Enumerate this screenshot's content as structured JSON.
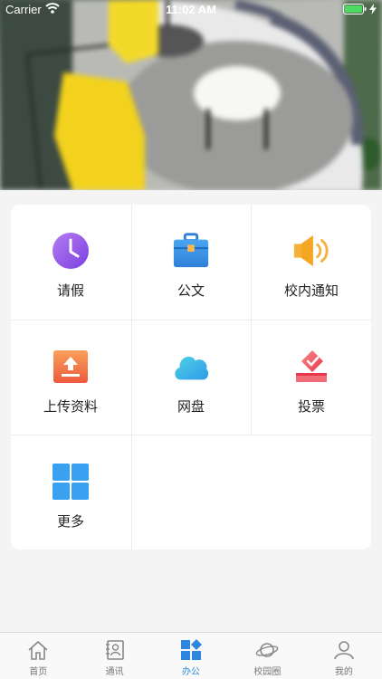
{
  "status_bar": {
    "carrier": "Carrier",
    "time": "11:02 AM"
  },
  "grid": {
    "items": [
      {
        "label": "请假",
        "icon": "clock-icon"
      },
      {
        "label": "公文",
        "icon": "briefcase-icon"
      },
      {
        "label": "校内通知",
        "icon": "speaker-icon"
      },
      {
        "label": "上传资料",
        "icon": "upload-icon"
      },
      {
        "label": "网盘",
        "icon": "cloud-icon"
      },
      {
        "label": "投票",
        "icon": "vote-icon"
      },
      {
        "label": "更多",
        "icon": "grid-icon"
      }
    ]
  },
  "tabbar": {
    "active": 2,
    "tabs": [
      {
        "label": "首页",
        "icon": "home-icon"
      },
      {
        "label": "通讯",
        "icon": "contacts-icon"
      },
      {
        "label": "办公",
        "icon": "office-icon"
      },
      {
        "label": "校园圈",
        "icon": "planet-icon"
      },
      {
        "label": "我的",
        "icon": "profile-icon"
      }
    ]
  },
  "colors": {
    "accent": "#2e86de",
    "clock": "#9b5de5",
    "briefcase": "#3a8ee6",
    "speaker": "#f6b13b",
    "upload": "#f1684a",
    "cloud": "#33b7e8",
    "vote": "#f0525e",
    "more": "#3aa0f0"
  }
}
